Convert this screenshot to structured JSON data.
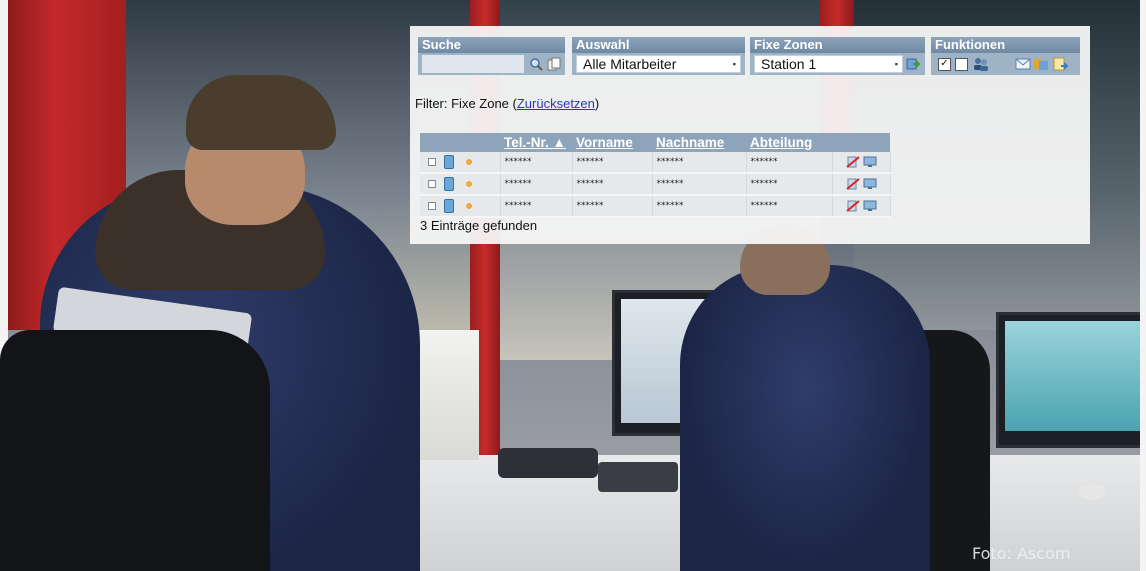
{
  "photo_credit": "Foto: Ascom",
  "sections": {
    "search": {
      "label": "Suche",
      "value": ""
    },
    "selection": {
      "label": "Auswahl",
      "value": "Alle Mitarbeiter"
    },
    "fixed_zones": {
      "label": "Fixe Zonen",
      "value": "Station 1"
    },
    "functions": {
      "label": "Funktionen"
    }
  },
  "filter": {
    "prefix": "Filter: Fixe Zone (",
    "reset_link": "Zurücksetzen",
    "suffix": ")"
  },
  "table": {
    "columns": [
      "Tel.-Nr. ▲",
      "Vorname",
      "Nachname",
      "Abteilung"
    ],
    "rows": [
      [
        "******",
        "******",
        "******",
        "******"
      ],
      [
        "******",
        "******",
        "******",
        "******"
      ],
      [
        "******",
        "******",
        "******",
        "******"
      ]
    ]
  },
  "summary": "3 Einträge gefunden",
  "colors": {
    "header_blue": "#8da4ba",
    "toolbar_blue": "#9fb3c6",
    "link_blue": "#1a3fb6",
    "panel_bg": "#f6f6f6"
  },
  "icons": {
    "search": "magnifier-icon",
    "search_extra": "copy-icon",
    "zone_go": "go-arrow-icon",
    "functions": [
      "checkbox-checked",
      "checkbox-empty",
      "users-icon",
      "mail-icon",
      "group-icon",
      "export-icon"
    ],
    "row_actions": [
      "edit-disabled-icon",
      "monitor-icon"
    ]
  }
}
